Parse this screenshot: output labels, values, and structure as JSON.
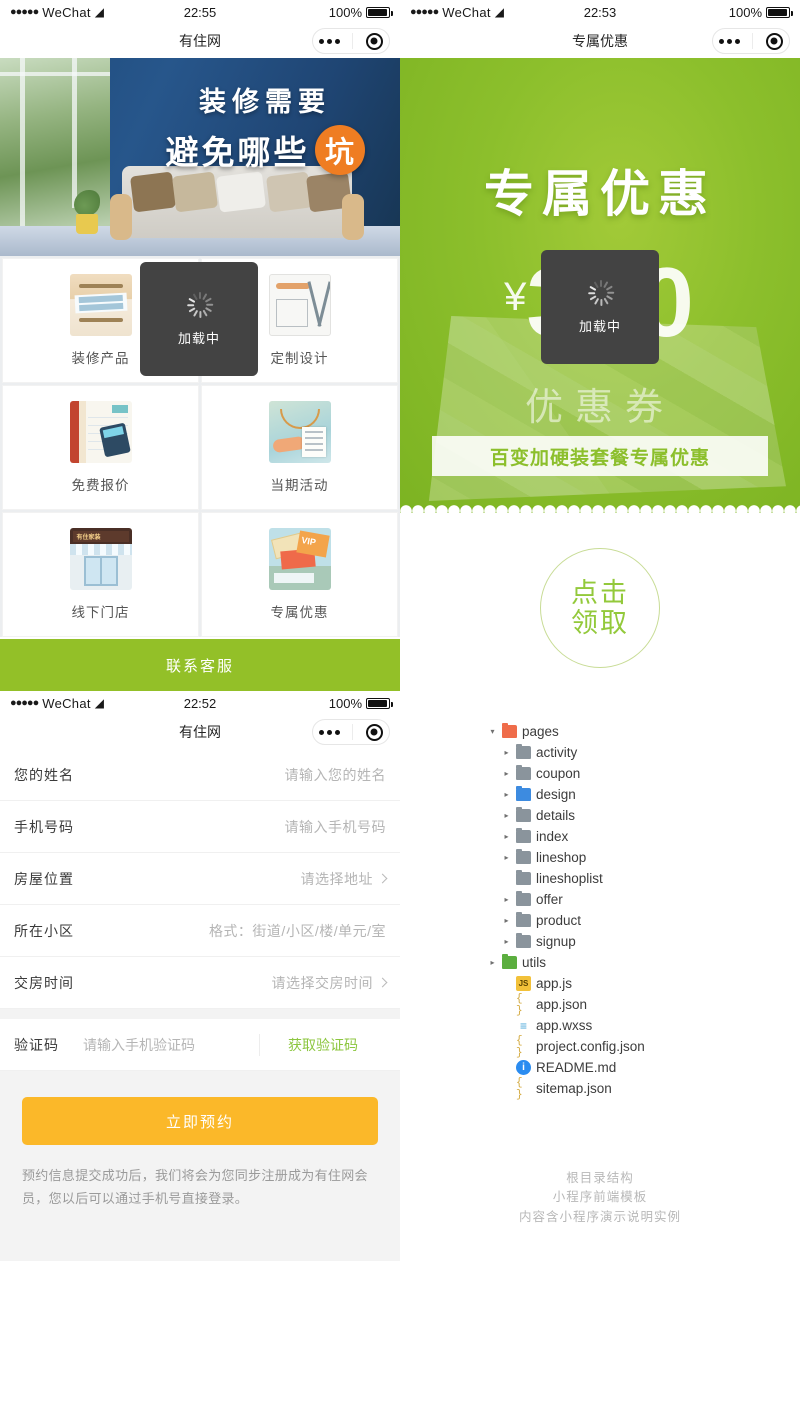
{
  "left_phone": {
    "status_bar": {
      "carrier": "WeChat",
      "dots": "●●●●●",
      "wifi_icon": "wifi-icon",
      "time": "22:55",
      "battery_pct": "100%"
    },
    "nav": {
      "title": "有住网",
      "capsule_more_icon": "more-dots-icon",
      "capsule_target_icon": "target-circle-icon"
    },
    "banner": {
      "line1": "装修需要",
      "line2": "避免哪些",
      "badge": "坑",
      "alt": "living-room-banner"
    },
    "grid": [
      {
        "label": "装修产品",
        "icon": "decoration-product-icon"
      },
      {
        "label": "定制设计",
        "icon": "custom-design-icon"
      },
      {
        "label": "免费报价",
        "icon": "free-quote-icon"
      },
      {
        "label": "当期活动",
        "icon": "current-activity-icon"
      },
      {
        "label": "线下门店",
        "icon": "offline-store-icon"
      },
      {
        "label": "专属优惠",
        "icon": "exclusive-offer-icon"
      }
    ],
    "contact_button": "联系客服",
    "loading_toast": {
      "text": "加载中",
      "icon": "spinner-icon"
    }
  },
  "form_phone": {
    "status_bar": {
      "carrier": "WeChat",
      "dots": "●●●●●",
      "wifi_icon": "wifi-icon",
      "time": "22:52",
      "battery_pct": "100%"
    },
    "nav": {
      "title": "有住网"
    },
    "rows": [
      {
        "label": "您的姓名",
        "placeholder": "请输入您的姓名",
        "chevron": false
      },
      {
        "label": "手机号码",
        "placeholder": "请输入手机号码",
        "chevron": false
      },
      {
        "label": "房屋位置",
        "placeholder": "请选择地址",
        "chevron": true
      },
      {
        "label": "所在小区",
        "placeholder": "格式：街道/小区/楼/单元/室",
        "chevron": false
      },
      {
        "label": "交房时间",
        "placeholder": "请选择交房时间",
        "chevron": true
      }
    ],
    "code_row": {
      "label": "验证码",
      "placeholder": "请输入手机验证码",
      "get_code": "获取验证码"
    },
    "submit_button": "立即预约",
    "foot_note": "预约信息提交成功后，我们将会为您同步注册成为有住网会员，您以后可以通过手机号直接登录。"
  },
  "right_phone": {
    "status_bar": {
      "carrier": "WeChat",
      "dots": "●●●●●",
      "wifi_icon": "wifi-icon",
      "time": "22:53",
      "battery_pct": "100%"
    },
    "nav": {
      "title": "专属优惠"
    },
    "hero": {
      "title": "专属优惠",
      "currency": "¥",
      "amount": "300",
      "subtitle": "优惠券",
      "ribbon": "百变加硬装套餐专属优惠"
    },
    "claim_button": {
      "line1": "点击",
      "line2": "领取"
    },
    "loading_toast": {
      "text": "加载中",
      "icon": "spinner-icon"
    }
  },
  "file_tree": {
    "nodes": [
      {
        "label": "pages",
        "level": 1,
        "icon": "folder-orange-icon",
        "arrow": "▾"
      },
      {
        "label": "activity",
        "level": 2,
        "icon": "folder-gray-icon",
        "arrow": "▸"
      },
      {
        "label": "coupon",
        "level": 2,
        "icon": "folder-gray-icon",
        "arrow": "▸"
      },
      {
        "label": "design",
        "level": 2,
        "icon": "folder-blue-icon",
        "arrow": "▸"
      },
      {
        "label": "details",
        "level": 2,
        "icon": "folder-gray-icon",
        "arrow": "▸"
      },
      {
        "label": "index",
        "level": 2,
        "icon": "folder-gray-icon",
        "arrow": "▸"
      },
      {
        "label": "lineshop",
        "level": 2,
        "icon": "folder-gray-icon",
        "arrow": "▸"
      },
      {
        "label": "lineshoplist",
        "level": 2,
        "icon": "folder-gray-icon",
        "arrow": ""
      },
      {
        "label": "offer",
        "level": 2,
        "icon": "folder-gray-icon",
        "arrow": "▸"
      },
      {
        "label": "product",
        "level": 2,
        "icon": "folder-gray-icon",
        "arrow": "▸"
      },
      {
        "label": "signup",
        "level": 2,
        "icon": "folder-gray-icon",
        "arrow": "▸"
      },
      {
        "label": "utils",
        "level": 1,
        "icon": "folder-green-icon",
        "arrow": "▸"
      },
      {
        "label": "app.js",
        "level": 2,
        "icon": "js-file-icon",
        "arrow": ""
      },
      {
        "label": "app.json",
        "level": 2,
        "icon": "json-file-icon",
        "arrow": ""
      },
      {
        "label": "app.wxss",
        "level": 2,
        "icon": "wxss-file-icon",
        "arrow": ""
      },
      {
        "label": "project.config.json",
        "level": 2,
        "icon": "json-file-icon",
        "arrow": ""
      },
      {
        "label": "README.md",
        "level": 2,
        "icon": "markdown-file-icon",
        "arrow": ""
      },
      {
        "label": "sitemap.json",
        "level": 2,
        "icon": "json-file-icon",
        "arrow": ""
      }
    ]
  },
  "watermark": {
    "line1": "根目录结构",
    "line2": "小程序前端模板",
    "line3": "内容含小程序演示说明实例"
  },
  "colors": {
    "green_brand": "#93c028",
    "green_hero": "#8cbf2c",
    "orange_badge": "#ef7d22",
    "yellow_submit": "#fbb829",
    "banner_blue": "#1e4a7a",
    "toast_bg": "#434343",
    "claim_green": "#93c93b"
  }
}
